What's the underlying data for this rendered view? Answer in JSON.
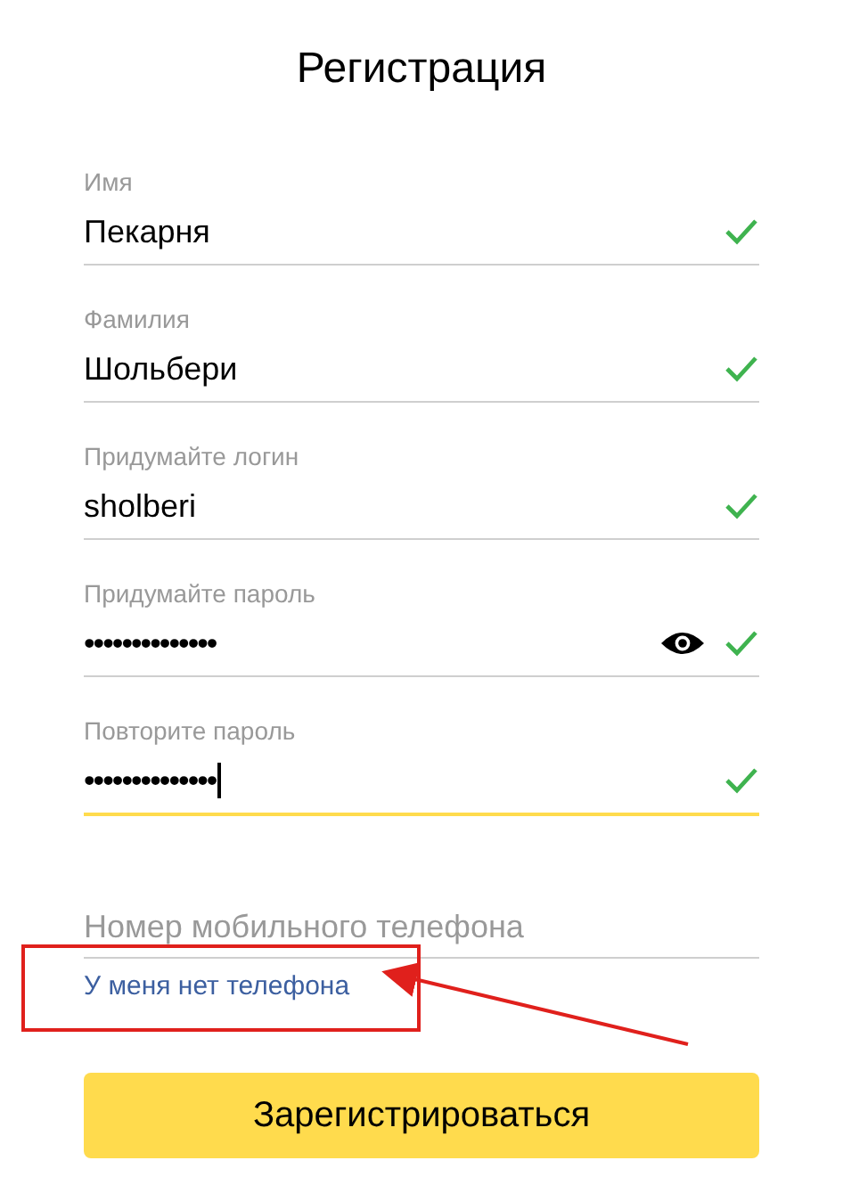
{
  "title": "Регистрация",
  "fields": [
    {
      "label": "Имя",
      "value": "Пекарня",
      "kind": "text",
      "valid": true,
      "focused": false
    },
    {
      "label": "Фамилия",
      "value": "Шольбери",
      "kind": "text",
      "valid": true,
      "focused": false
    },
    {
      "label": "Придумайте логин",
      "value": "sholberi",
      "kind": "text",
      "valid": true,
      "focused": false
    },
    {
      "label": "Придумайте пароль",
      "value": "••••••••••••••",
      "kind": "password",
      "valid": true,
      "focused": false
    },
    {
      "label": "Повторите пароль",
      "value": "••••••••••••••",
      "kind": "confirm",
      "valid": true,
      "focused": true
    }
  ],
  "phone": {
    "placeholder": "Номер мобильного телефона"
  },
  "no_phone_link": "У меня нет телефона",
  "submit_button": "Зарегистрироваться"
}
